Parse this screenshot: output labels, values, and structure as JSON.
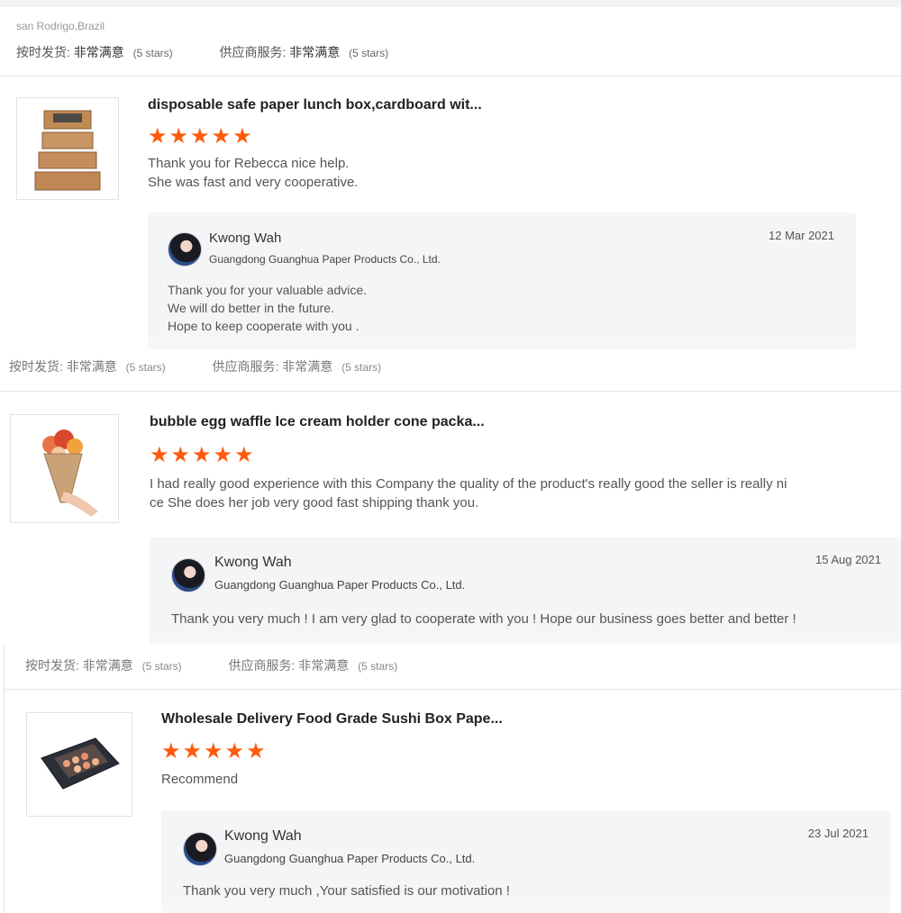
{
  "reviewer_location": "san Rodrigo,Brazil",
  "ratings": [
    {
      "ontime_label": "按时发货:",
      "ontime_value": "非常满意",
      "ontime_stars": "(5 stars)",
      "service_label": "供应商服务:",
      "service_value": "非常满意",
      "service_stars": "(5 stars)"
    },
    {
      "ontime_label": "按时发货:",
      "ontime_value": "非常满意",
      "ontime_stars": "(5 stars)",
      "service_label": "供应商服务:",
      "service_value": "非常满意",
      "service_stars": "(5 stars)"
    },
    {
      "ontime_label": "按时发货:",
      "ontime_value": "非常满意",
      "ontime_stars": "(5 stars)",
      "service_label": "供应商服务:",
      "service_value": "非常满意",
      "service_stars": "(5 stars)"
    }
  ],
  "reviews": [
    {
      "title": "disposable safe paper lunch box,cardboard wit...",
      "stars": 5,
      "comment_lines": [
        "Thank you for Rebecca nice help.",
        "She was fast and very cooperative."
      ],
      "image_icon": "kraft-box-stack-icon",
      "reply": {
        "name": "Kwong Wah",
        "company": "Guangdong Guanghua Paper Products Co., Ltd.",
        "date": "12 Mar 2021",
        "lines": [
          "Thank you for your valuable advice.",
          "We will do better in the future.",
          "Hope to keep cooperate with you ."
        ]
      }
    },
    {
      "title": "bubble egg waffle Ice cream holder cone packa...",
      "stars": 5,
      "comment_lines": [
        "I had really good experience with this  Company the quality of the product's really good the seller is really ni",
        "ce She does her job very good fast shipping thank you."
      ],
      "image_icon": "ice-cream-cone-icon",
      "reply": {
        "name": "Kwong Wah",
        "company": "Guangdong Guanghua Paper Products Co., Ltd.",
        "date": "15 Aug 2021",
        "lines": [
          "Thank you very much ! I am very glad to cooperate with you ! Hope our business goes better and better !"
        ]
      }
    },
    {
      "title": "Wholesale Delivery Food Grade Sushi Box Pape...",
      "stars": 5,
      "comment_lines": [
        "Recommend"
      ],
      "image_icon": "sushi-box-icon",
      "reply": {
        "name": "Kwong Wah",
        "company": "Guangdong Guanghua Paper Products Co., Ltd.",
        "date": "23 Jul 2021",
        "lines": [
          "Thank you very much  ,Your satisfied is our motivation !"
        ]
      }
    }
  ],
  "colors": {
    "star": "#ff5a0e",
    "reply_bg": "#f4f5f7"
  }
}
